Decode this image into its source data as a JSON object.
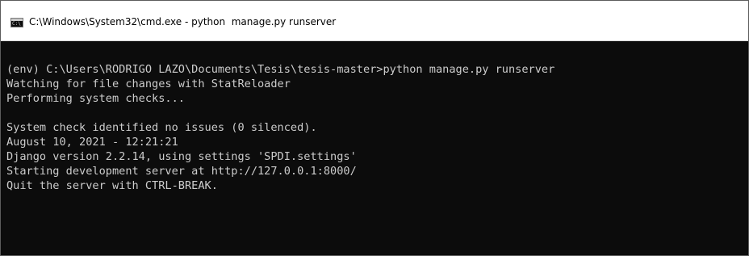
{
  "window": {
    "title": "C:\\Windows\\System32\\cmd.exe - python  manage.py runserver",
    "icon": "cmd-icon",
    "icon_glyph": "C:\\",
    "colors": {
      "console_background": "#0c0c0c",
      "console_text": "#cccccc",
      "titlebar_background": "#ffffff"
    }
  },
  "console": {
    "lines": [
      "(env) C:\\Users\\RODRIGO LAZO\\Documents\\Tesis\\tesis-master>python manage.py runserver",
      "Watching for file changes with StatReloader",
      "Performing system checks...",
      "",
      "System check identified no issues (0 silenced).",
      "August 10, 2021 - 12:21:21",
      "Django version 2.2.14, using settings 'SPDI.settings'",
      "Starting development server at http://127.0.0.1:8000/",
      "Quit the server with CTRL-BREAK."
    ]
  }
}
